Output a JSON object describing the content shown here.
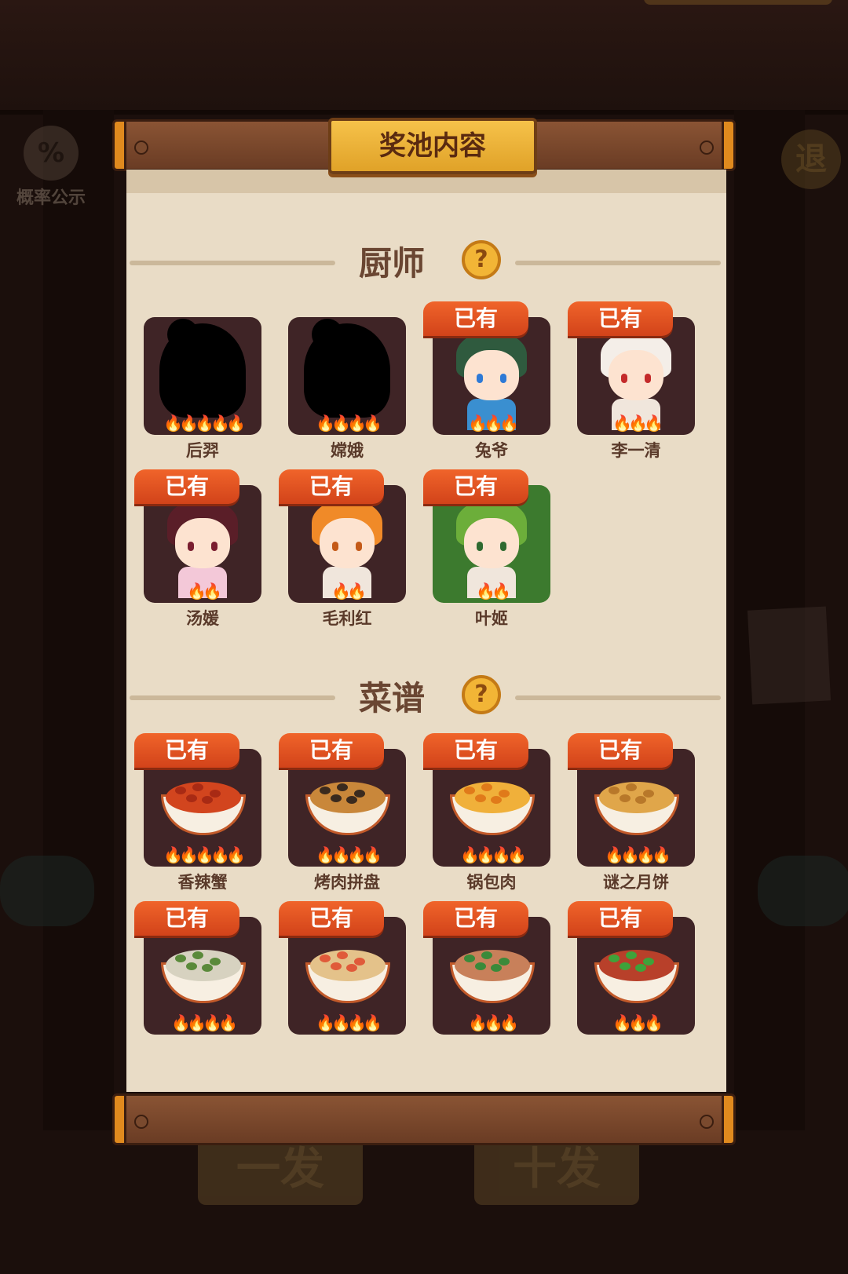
{
  "title": "奖池内容",
  "background": {
    "probability_label": "概率公示",
    "probability_icon": "%",
    "exit_label": "退",
    "single_pull_label": "一发",
    "ten_pull_label": "十发"
  },
  "sections": {
    "chefs": {
      "label": "厨师",
      "help_icon": "?",
      "items": [
        {
          "name": "后羿",
          "owned": false,
          "owned_label": "",
          "stars": 5,
          "locked": true
        },
        {
          "name": "嫦娥",
          "owned": false,
          "owned_label": "",
          "stars": 4,
          "locked": true
        },
        {
          "name": "兔爷",
          "owned": true,
          "owned_label": "已有",
          "stars": 3
        },
        {
          "name": "李一清",
          "owned": true,
          "owned_label": "已有",
          "stars": 3
        },
        {
          "name": "汤媛",
          "owned": true,
          "owned_label": "已有",
          "stars": 2
        },
        {
          "name": "毛利红",
          "owned": true,
          "owned_label": "已有",
          "stars": 2
        },
        {
          "name": "叶姬",
          "owned": true,
          "owned_label": "已有",
          "stars": 2
        }
      ]
    },
    "recipes": {
      "label": "菜谱",
      "help_icon": "?",
      "items": [
        {
          "name": "香辣蟹",
          "owned": true,
          "owned_label": "已有",
          "stars": 5
        },
        {
          "name": "烤肉拼盘",
          "owned": true,
          "owned_label": "已有",
          "stars": 4
        },
        {
          "name": "锅包肉",
          "owned": true,
          "owned_label": "已有",
          "stars": 4
        },
        {
          "name": "谜之月饼",
          "owned": true,
          "owned_label": "已有",
          "stars": 4
        },
        {
          "name": "",
          "owned": true,
          "owned_label": "已有",
          "stars": 4
        },
        {
          "name": "",
          "owned": true,
          "owned_label": "已有",
          "stars": 4
        },
        {
          "name": "",
          "owned": true,
          "owned_label": "已有",
          "stars": 3
        },
        {
          "name": "",
          "owned": true,
          "owned_label": "已有",
          "stars": 3
        }
      ]
    }
  },
  "colors": {
    "badge": "#e2501f",
    "paper": "#e9dcc6",
    "card": "#3f2426",
    "plaque": "#f2b536"
  }
}
